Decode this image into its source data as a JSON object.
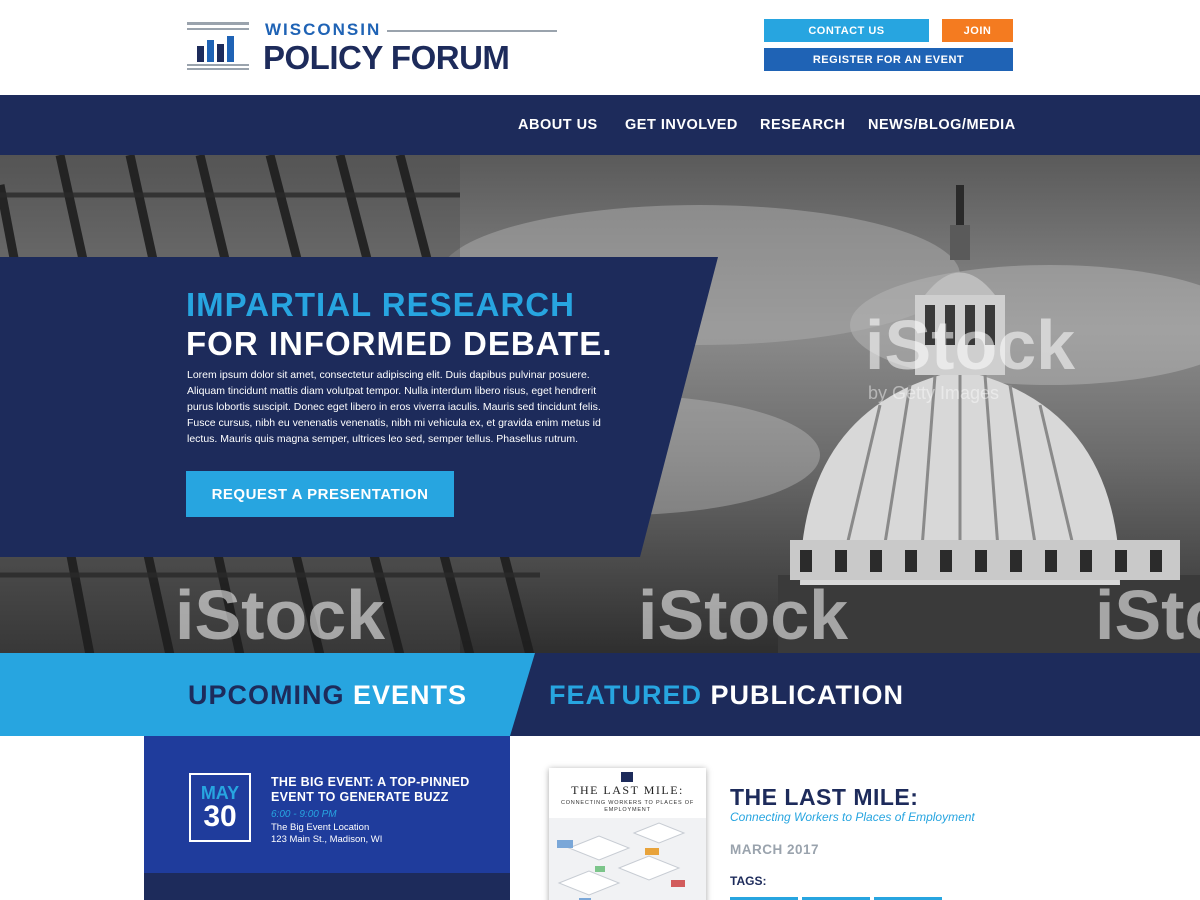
{
  "header": {
    "logo_top": "WISCONSIN",
    "logo_bottom": "POLICY FORUM",
    "buttons": {
      "contact": "CONTACT US",
      "join": "JOIN",
      "register": "REGISTER FOR AN EVENT"
    }
  },
  "nav": {
    "items": [
      "ABOUT US",
      "GET INVOLVED",
      "RESEARCH",
      "NEWS/BLOG/MEDIA"
    ]
  },
  "hero": {
    "title_line1": "IMPARTIAL RESEARCH",
    "title_line2": "FOR INFORMED DEBATE.",
    "body": "Lorem ipsum dolor sit amet, consectetur adipiscing elit. Duis dapibus pulvinar posuere. Aliquam tincidunt mattis diam volutpat tempor. Nulla interdum libero risus, eget hendrerit purus lobortis suscipit. Donec eget libero in eros viverra iaculis. Mauris sed tincidunt felis. Fusce cursus, nibh eu venenatis venenatis, nibh mi vehicula ex, et gravida enim metus id lectus. Mauris quis magna semper, ultrices leo sed, semper tellus. Phasellus rutrum.",
    "cta": "REQUEST A PRESENTATION",
    "watermark": "iStock",
    "watermark_sub": "by Getty Images"
  },
  "sections": {
    "events": {
      "word1": "UPCOMING",
      "word2": "EVENTS"
    },
    "publication": {
      "word1": "FEATURED",
      "word2": "PUBLICATION"
    }
  },
  "event": {
    "month": "MAY",
    "day": "30",
    "title": "THE BIG EVENT: A TOP-PINNED EVENT TO GENERATE BUZZ",
    "time": "6:00 - 9:00 PM",
    "location": "The Big Event Location",
    "address": "123 Main St., Madison, WI"
  },
  "publication": {
    "cover_title": "THE LAST MILE:",
    "cover_subtitle": "CONNECTING WORKERS TO PLACES OF EMPLOYMENT",
    "title": "THE LAST MILE:",
    "subtitle": "Connecting Workers to Places of Employment",
    "date": "MARCH 2017",
    "tags_label": "TAGS:"
  },
  "colors": {
    "navy": "#1d2b5b",
    "blue": "#27a5e0",
    "royal": "#1f63b5",
    "orange": "#f47b20",
    "events_bg": "#1f3c9c"
  }
}
